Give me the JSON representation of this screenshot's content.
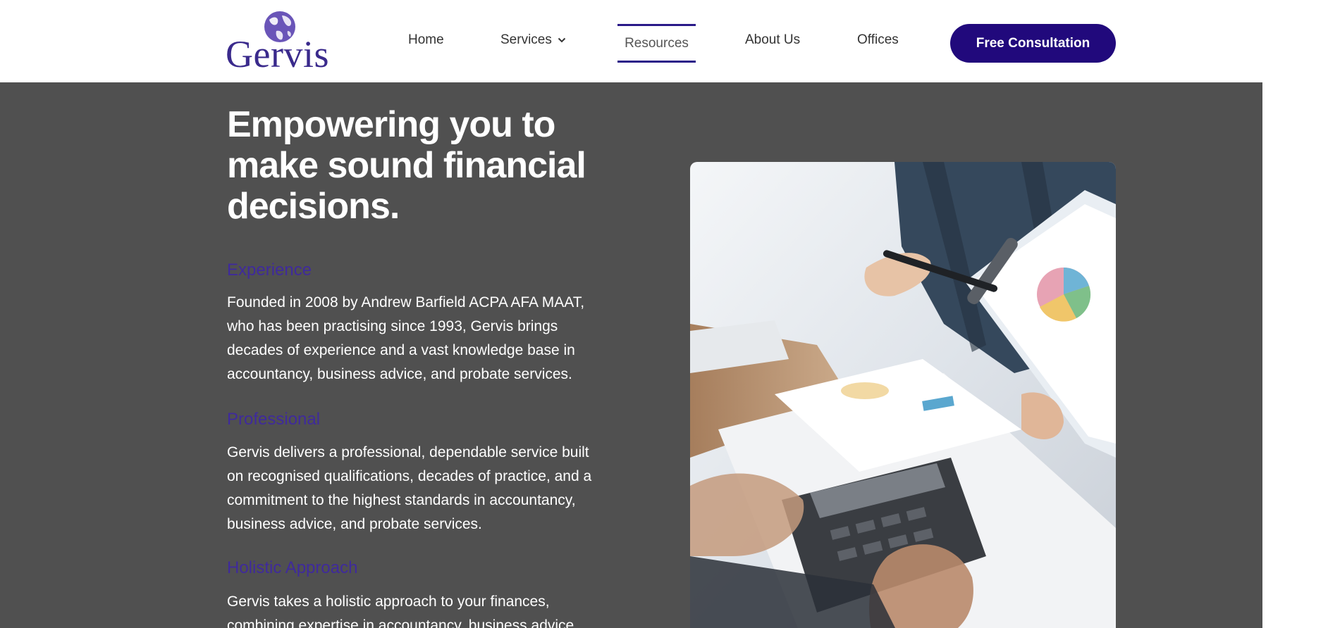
{
  "header": {
    "logo_text": "Gervis",
    "nav": {
      "home": "Home",
      "services": "Services",
      "resources": "Resources",
      "about": "About Us",
      "offices": "Offices"
    },
    "cta_label": "Free Consultation"
  },
  "hero": {
    "headline": "Empowering you to make sound financial decisions.",
    "features": [
      {
        "title": "Experience",
        "body": "Founded in 2008 by Andrew Barfield ACPA AFA MAAT, who has been practising since 1993, Gervis brings decades of experience and a vast knowledge base in accountancy, business advice, and probate services."
      },
      {
        "title": "Professional",
        "body": "Gervis delivers a professional, dependable service built on recognised qualifications, decades of practice, and a commitment to the highest standards in accountancy, business advice, and probate services."
      },
      {
        "title": "Holistic Approach",
        "body": "Gervis takes a holistic approach to your finances, combining expertise in accountancy, business advice"
      }
    ]
  },
  "colors": {
    "brand": "#21097c",
    "accent_text": "#3f2a9c",
    "section_bg": "#505050"
  },
  "icons": {
    "services_dropdown": "chevron-down-icon",
    "logo_mark": "globe-icon"
  }
}
